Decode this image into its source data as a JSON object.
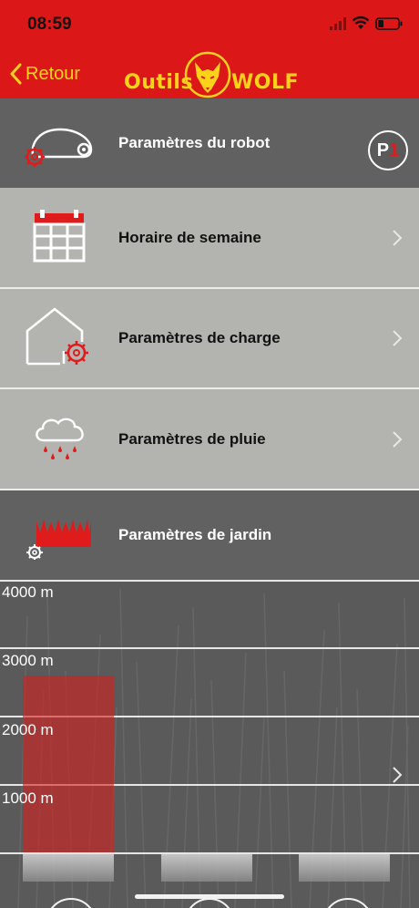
{
  "status_bar": {
    "time": "08:59"
  },
  "nav": {
    "back_label": "Retour"
  },
  "logo": {
    "left_text": "Outils",
    "right_text": "WOLF"
  },
  "menu": {
    "robot": {
      "label": "Paramètres du robot",
      "badge_p": "P",
      "badge_num": "1"
    },
    "week": {
      "label": "Horaire de semaine"
    },
    "charge": {
      "label": "Paramètres de charge"
    },
    "rain": {
      "label": "Paramètres de pluie"
    },
    "garden": {
      "label": "Paramètres de jardin"
    }
  },
  "colors": {
    "brand_red": "#dc1717",
    "brand_yellow": "#ffd21a",
    "dark_row": "#616161",
    "light_row": "#b3b3af"
  },
  "chart_data": {
    "type": "bar",
    "y_ticks": [
      "4000 m",
      "3000 m",
      "2000 m",
      "1000 m"
    ],
    "ylim": [
      0,
      4000
    ],
    "values": [
      2600
    ]
  }
}
